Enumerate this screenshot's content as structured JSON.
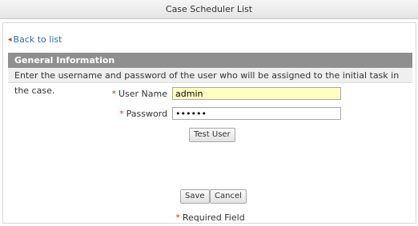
{
  "window": {
    "title": "Case Scheduler List"
  },
  "nav": {
    "back_label": "Back to list"
  },
  "section": {
    "title": "General Information",
    "description": "Enter the username and password of the user who will be assigned to the initial task in the case."
  },
  "form": {
    "required_mark": "*",
    "username": {
      "label": "User Name",
      "value": "admin"
    },
    "password": {
      "label": "Password",
      "value": "••••••"
    }
  },
  "buttons": {
    "test_user": "Test User",
    "save": "Save",
    "cancel": "Cancel"
  },
  "footer": {
    "required_mark": "*",
    "required_text": "Required Field"
  },
  "colors": {
    "required": "#c0392b",
    "link": "#2a6fb0",
    "section_header": "#8f8f8f",
    "active_field": "#ffffc0"
  }
}
